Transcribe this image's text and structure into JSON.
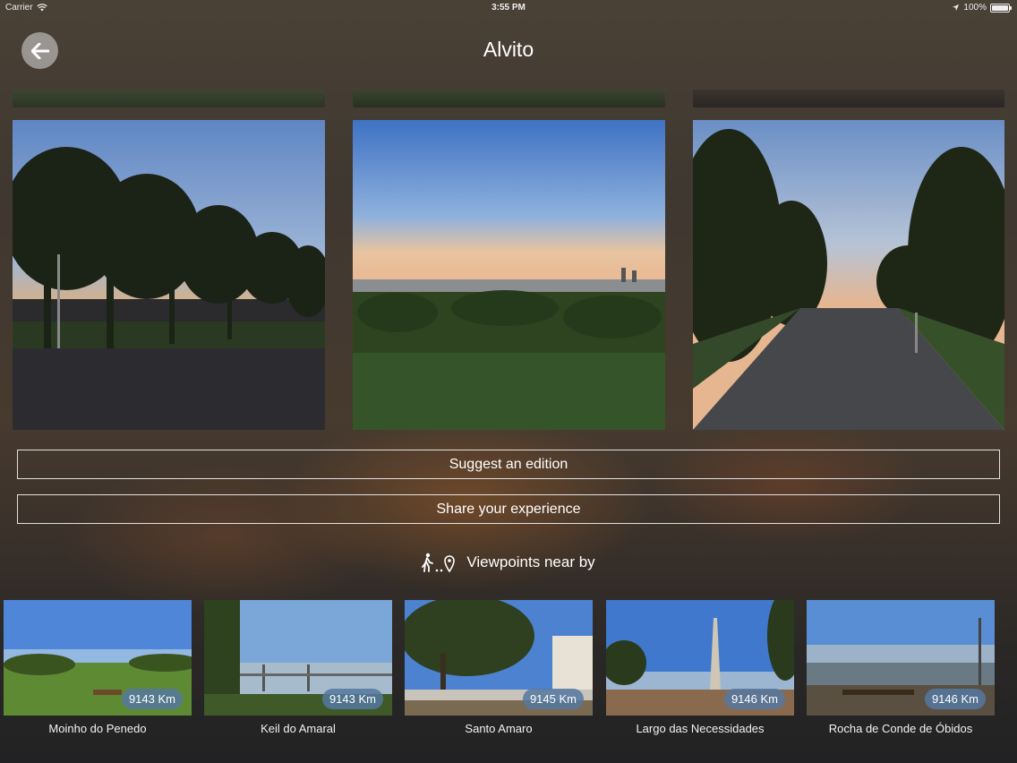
{
  "status_bar": {
    "carrier": "Carrier",
    "time": "3:55 PM",
    "battery": "100%"
  },
  "header": {
    "title": "Alvito"
  },
  "actions": {
    "suggest_label": "Suggest an edition",
    "share_label": "Share your experience"
  },
  "nearby": {
    "title": "Viewpoints near by",
    "items": [
      {
        "name": "Moinho do Penedo",
        "distance": "9143 Km"
      },
      {
        "name": "Keil do Amaral",
        "distance": "9143 Km"
      },
      {
        "name": "Santo Amaro",
        "distance": "9145 Km"
      },
      {
        "name": "Largo das Necessidades",
        "distance": "9146 Km"
      },
      {
        "name": "Rocha de Conde de Óbidos",
        "distance": "9146 Km"
      }
    ]
  },
  "icons": {
    "back": "arrow-left-icon",
    "nearby": "walking-person-pin-icon",
    "wifi": "wifi-icon",
    "location": "location-arrow-icon",
    "battery": "battery-icon"
  },
  "colors": {
    "distance_badge": "#5578a0",
    "button_border": "#ffffff"
  }
}
